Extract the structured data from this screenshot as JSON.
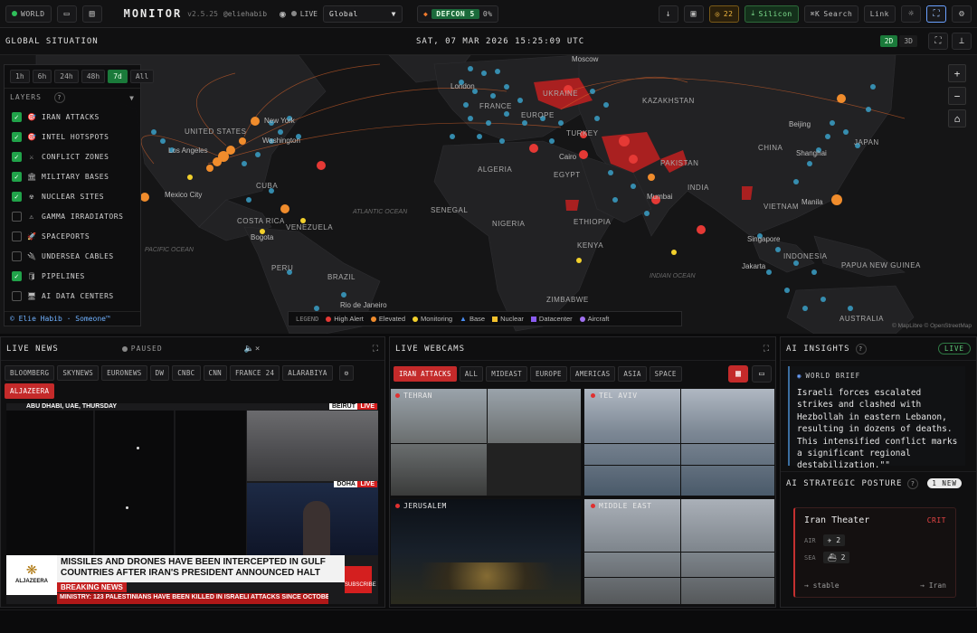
{
  "topbar": {
    "world_label": "WORLD",
    "brand": "MONITOR",
    "version": "v2.5.25",
    "handle": "@eliehabib",
    "live_label": "LIVE",
    "region_select": "Global",
    "defcon_label": "DEFCON 5",
    "defcon_pct": "0%",
    "alerts_count": "22",
    "silicon_label": "Silicon",
    "search_label": "Search",
    "search_shortcut": "⌘K",
    "link_label": "Link"
  },
  "map": {
    "section_title": "GLOBAL SITUATION",
    "datetime": "SAT, 07 MAR 2026 15:25:09 UTC",
    "view_2d": "2D",
    "view_3d": "3D",
    "timeframes": [
      "1h",
      "6h",
      "24h",
      "48h",
      "7d",
      "All"
    ],
    "active_timeframe": "7d",
    "layers_title": "LAYERS",
    "layers": [
      {
        "label": "IRAN ATTACKS",
        "on": true,
        "icon": "🎯"
      },
      {
        "label": "INTEL HOTSPOTS",
        "on": true,
        "icon": "🎯"
      },
      {
        "label": "CONFLICT ZONES",
        "on": true,
        "icon": "⚔"
      },
      {
        "label": "MILITARY BASES",
        "on": true,
        "icon": "🏛"
      },
      {
        "label": "NUCLEAR SITES",
        "on": true,
        "icon": "☢"
      },
      {
        "label": "GAMMA IRRADIATORS",
        "on": false,
        "icon": "⚠"
      },
      {
        "label": "SPACEPORTS",
        "on": false,
        "icon": "🚀"
      },
      {
        "label": "UNDERSEA CABLES",
        "on": false,
        "icon": "🔌"
      },
      {
        "label": "PIPELINES",
        "on": true,
        "icon": "🛢"
      },
      {
        "label": "AI DATA CENTERS",
        "on": false,
        "icon": "🖥"
      }
    ],
    "layers_footer": "© Elie Habib · Someone™",
    "legend_title": "LEGEND",
    "legend": [
      {
        "label": "High Alert",
        "color": "#e53935",
        "shape": "circle"
      },
      {
        "label": "Elevated",
        "color": "#f08c2c",
        "shape": "circle"
      },
      {
        "label": "Monitoring",
        "color": "#f2d02c",
        "shape": "circle"
      },
      {
        "label": "Base",
        "color": "#4a8cf0",
        "shape": "triangle"
      },
      {
        "label": "Nuclear",
        "color": "#f2c02c",
        "shape": "square"
      },
      {
        "label": "Datacenter",
        "color": "#8a5cf0",
        "shape": "square"
      },
      {
        "label": "Aircraft",
        "color": "#a070f0",
        "shape": "circle"
      }
    ],
    "attribution": "© MapLibre © OpenStreetMap",
    "labels": {
      "moscow": "Moscow",
      "london": "London",
      "ukraine": "UKRAINE",
      "france": "FRANCE",
      "europe": "EUROPE",
      "kazakhstan": "KAZAKHSTAN",
      "beijing": "Beijing",
      "china": "CHINA",
      "shanghai": "Shanghai",
      "japan": "JAPAN",
      "turkey": "TURKEY",
      "cairo": "Cairo",
      "egypt": "EGYPT",
      "algeria": "ALGERIA",
      "pakistan": "PAKISTAN",
      "india": "INDIA",
      "mumbai": "Mumbai",
      "senegal": "SENEGAL",
      "nigeria": "NIGERIA",
      "ethiopia": "ETHIOPIA",
      "kenya": "KENYA",
      "vietnam": "VIETNAM",
      "manila": "Manila",
      "singapore": "Singapore",
      "indonesia": "INDONESIA",
      "jakarta": "Jakarta",
      "png": "PAPUA NEW GUINEA",
      "united_states": "UNITED STATES",
      "new_york": "New York",
      "los_angeles": "Los Angeles",
      "washington": "Washington",
      "mexico_city": "Mexico City",
      "cuba": "CUBA",
      "costa_rica": "COSTA RICA",
      "venezuela": "VENEZUELA",
      "bogota": "Bogota",
      "peru": "PERU",
      "brazil": "BRAZIL",
      "rio": "Rio de Janeiro",
      "zimbabwe": "ZIMBABWE",
      "atlantic": "ATLANTIC OCEAN",
      "indian_ocean": "INDIAN OCEAN",
      "pacific": "PACIFIC OCEAN",
      "australia": "AUSTRALIA"
    }
  },
  "news": {
    "title": "LIVE NEWS",
    "status": "PAUSED",
    "channels": [
      "BLOOMBERG",
      "SKYNEWS",
      "EURONEWS",
      "DW",
      "CNBC",
      "CNN",
      "FRANCE 24",
      "ALARABIYA",
      "ALJAZEERA"
    ],
    "active_channel": "ALJAZEERA",
    "dateline": "ABU DHABI, UAE, THURSDAY",
    "city1": "BEIRUT",
    "city2": "DOHA",
    "live_tag": "LIVE",
    "headline": "MISSILES AND DRONES HAVE BEEN INTERCEPTED IN GULF COUNTRIES AFTER IRAN'S PRESIDENT ANNOUNCED HALT",
    "breaking": "BREAKING NEWS",
    "ticker": "MINISTRY: 123 PALESTINIANS HAVE BEEN KILLED IN ISRAELI ATTACKS SINCE OCTOBER 2023",
    "logo_text": "ALJAZEERA",
    "subscribe": "SUBSCRIBE"
  },
  "webcams": {
    "title": "LIVE WEBCAMS",
    "filters": [
      "IRAN ATTACKS",
      "ALL",
      "MIDEAST",
      "EUROPE",
      "AMERICAS",
      "ASIA",
      "SPACE"
    ],
    "active_filter": "IRAN ATTACKS",
    "cams": [
      "TEHRAN",
      "TEL AVIV",
      "JERUSALEM",
      "MIDDLE EAST"
    ]
  },
  "insights": {
    "title": "AI INSIGHTS",
    "live": "LIVE",
    "brief_title": "WORLD BRIEF",
    "brief_text": "Israeli forces escalated strikes and clashed with Hezbollah in eastern Lebanon, resulting in dozens of deaths. This intensified conflict marks a significant regional destabilization.\"\"",
    "posture_title": "AI STRATEGIC POSTURE",
    "posture_badge": "1 NEW",
    "theater_name": "Iran Theater",
    "theater_level": "CRIT",
    "air_label": "AIR",
    "air_value": "2",
    "sea_label": "SEA",
    "sea_value": "2",
    "trend": "stable",
    "region": "Iran"
  }
}
